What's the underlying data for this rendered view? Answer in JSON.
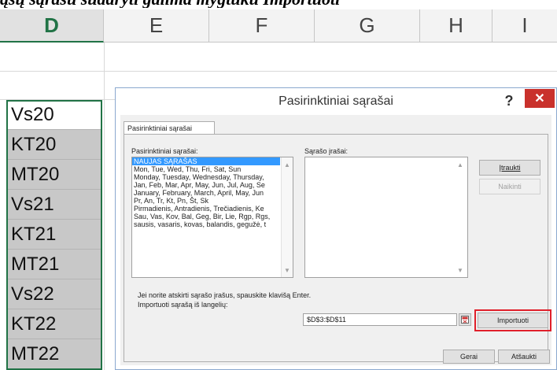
{
  "top_text": "ąsų sąrašu sudaryti galima mygtuku Importuoti",
  "columns": [
    "D",
    "E",
    "F",
    "G",
    "H",
    "I"
  ],
  "cells": [
    "Vs20",
    "KT20",
    "MT20",
    "Vs21",
    "KT21",
    "MT21",
    "Vs22",
    "KT22",
    "MT22"
  ],
  "dialog": {
    "title": "Pasirinktiniai sąrašai",
    "help": "?",
    "close": "✕",
    "tab": "Pasirinktiniai sąrašai",
    "lists_label": "Pasirinktiniai sąrašai:",
    "entries_label": "Sąrašo įrašai:",
    "list_items": [
      "NAUJAS SĄRAŠAS",
      "Mon, Tue, Wed, Thu, Fri, Sat, Sun",
      "Monday, Tuesday, Wednesday, Thursday,",
      "Jan, Feb, Mar, Apr, May, Jun, Jul, Aug, Se",
      "January, February, March, April, May, Jun",
      "Pr, An, Tr, Kt, Pn, Št, Sk",
      "Pirmadienis, Antradienis, Trečiadienis, Ke",
      "Sau, Vas, Kov, Bal, Geg, Bir, Lie, Rgp, Rgs,",
      "sausis, vasaris, kovas, balandis, gegužė, t"
    ],
    "add_button": "Įtraukti",
    "delete_button": "Naikinti",
    "hint": "Jei norite atskirti sąrašo įrašus, spauskite klavišą Enter.",
    "import_label": "Importuoti sąrašą iš langelių:",
    "import_range": "$D$3:$D$11",
    "import_button": "Importuoti",
    "ok_button": "Gerai",
    "cancel_button": "Atšaukti"
  }
}
